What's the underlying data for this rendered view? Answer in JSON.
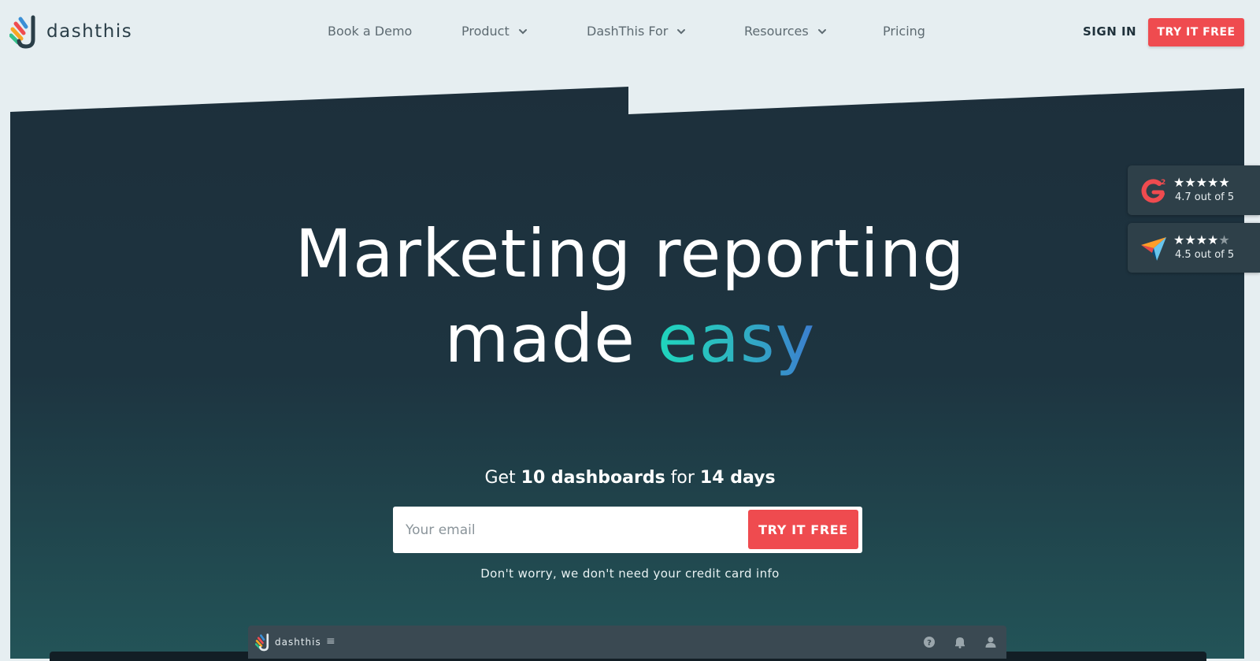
{
  "brand": {
    "name": "dashthis"
  },
  "nav": {
    "items": [
      {
        "label": "Book a Demo",
        "dropdown": false
      },
      {
        "label": "Product",
        "dropdown": true
      },
      {
        "label": "DashThis For",
        "dropdown": true
      },
      {
        "label": "Resources",
        "dropdown": true
      },
      {
        "label": "Pricing",
        "dropdown": false
      }
    ],
    "sign_in": "SIGN IN",
    "try_free": "TRY IT FREE"
  },
  "hero": {
    "headline_line1": "Marketing reporting",
    "headline_line2_prefix": "made ",
    "headline_highlight": "easy",
    "offer": {
      "prefix": "Get ",
      "count": "10 dashboards",
      "middle": " for ",
      "duration": "14 days"
    },
    "email_placeholder": "Your email",
    "cta": "TRY IT FREE",
    "disclaimer": "Don't worry, we don't need your credit card info"
  },
  "ratings": [
    {
      "icon": "g2-logo-icon",
      "stars_full": 5,
      "text": "4.7 out of 5"
    },
    {
      "icon": "capterra-logo-icon",
      "stars_full": 4,
      "stars_half": true,
      "text": "4.5 out of 5"
    }
  ],
  "preview": {
    "brand": "dashthis",
    "menu_glyph": "≡"
  },
  "colors": {
    "accent_red": "#ef4b4f",
    "hero_dark": "#1d2f3b",
    "hero_teal": "#235458",
    "easy_gradient_start": "#1fd6bd",
    "easy_gradient_end": "#3c7dd0",
    "page_bg": "#e6eef1"
  }
}
